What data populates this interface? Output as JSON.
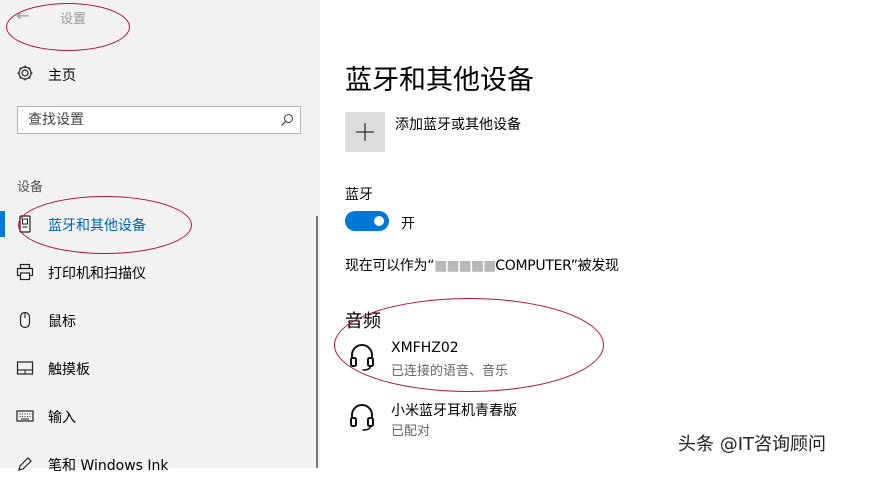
{
  "window": {
    "back_glyph": "←",
    "title": "设置"
  },
  "sidebar": {
    "home_label": "主页",
    "search_placeholder": "查找设置",
    "section_label": "设备",
    "items": [
      {
        "label": "蓝牙和其他设备",
        "icon": "bluetooth-devices-icon",
        "active": true
      },
      {
        "label": "打印机和扫描仪",
        "icon": "printer-icon"
      },
      {
        "label": "鼠标",
        "icon": "mouse-icon"
      },
      {
        "label": "触摸板",
        "icon": "touchpad-icon"
      },
      {
        "label": "输入",
        "icon": "keyboard-icon"
      },
      {
        "label": "笔和 Windows Ink",
        "icon": "pen-icon"
      }
    ]
  },
  "main": {
    "title": "蓝牙和其他设备",
    "add_device_label": "添加蓝牙或其他设备",
    "bluetooth_label": "蓝牙",
    "bluetooth_state": "开",
    "discoverable_prefix": "现在可以作为“",
    "discoverable_hidden": "■■■■■",
    "discoverable_suffix": "COMPUTER”被发现",
    "audio_heading": "音频",
    "devices": [
      {
        "name": "XMFHZ02",
        "status": "已连接的语音、音乐",
        "icon": "headset-icon"
      },
      {
        "name": "小米蓝牙耳机青春版",
        "status": "已配对",
        "icon": "headset-icon"
      }
    ]
  },
  "watermark": "头条 @IT咨询顾问",
  "colors": {
    "accent": "#0078d7",
    "active_text": "#0063b1",
    "annotation": "#b0123a"
  }
}
